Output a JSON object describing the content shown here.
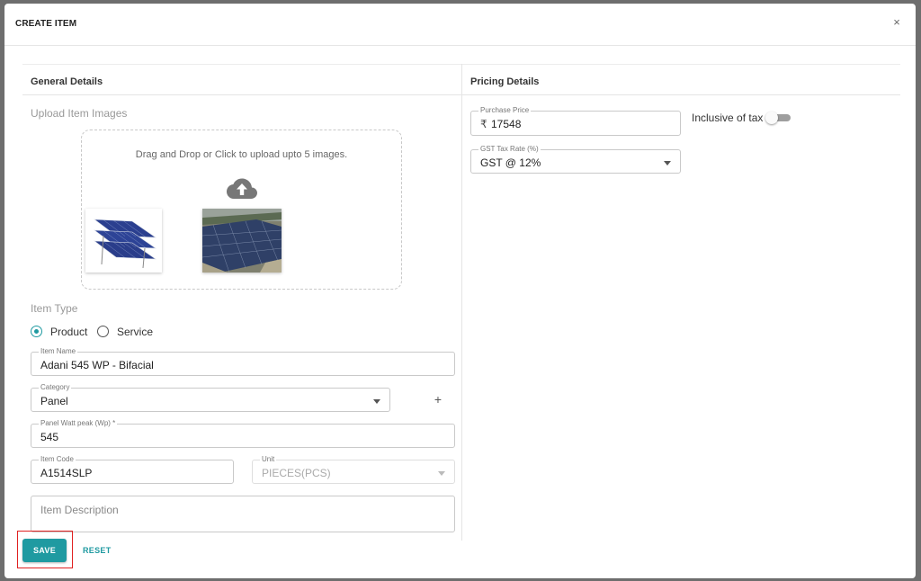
{
  "modal": {
    "title": "CREATE ITEM",
    "close_glyph": "×"
  },
  "general": {
    "title": "General Details",
    "upload_label": "Upload Item Images",
    "drop_text": "Drag and Drop or Click to upload upto 5 images.",
    "upload_icon": "cloud-upload-icon",
    "item_type_label": "Item Type",
    "item_type_options": [
      "Product",
      "Service"
    ],
    "item_type_selected": "Product",
    "item_name": {
      "label": "Item Name",
      "value": "Adani 545 WP - Bifacial"
    },
    "category": {
      "label": "Category",
      "value": "Panel"
    },
    "add_glyph": "+",
    "panel_watt_peak": {
      "label": "Panel Watt peak (Wp) *",
      "value": "545"
    },
    "item_code": {
      "label": "Item Code",
      "value": "A1514SLP"
    },
    "unit": {
      "label": "Unit",
      "value": "PIECES(PCS)"
    },
    "item_description": {
      "placeholder": "Item Description"
    }
  },
  "pricing": {
    "title": "Pricing Details",
    "purchase_price": {
      "label": "Purchase Price",
      "currency": "₹",
      "value": "17548"
    },
    "inclusive_of_tax": {
      "label": "Inclusive of tax",
      "on": false
    },
    "gst": {
      "label": "GST Tax Rate (%)",
      "value": "GST @ 12%"
    }
  },
  "actions": {
    "save": "SAVE",
    "reset": "RESET"
  },
  "colors": {
    "accent": "#1f9aa1",
    "highlight": "#e02020"
  }
}
